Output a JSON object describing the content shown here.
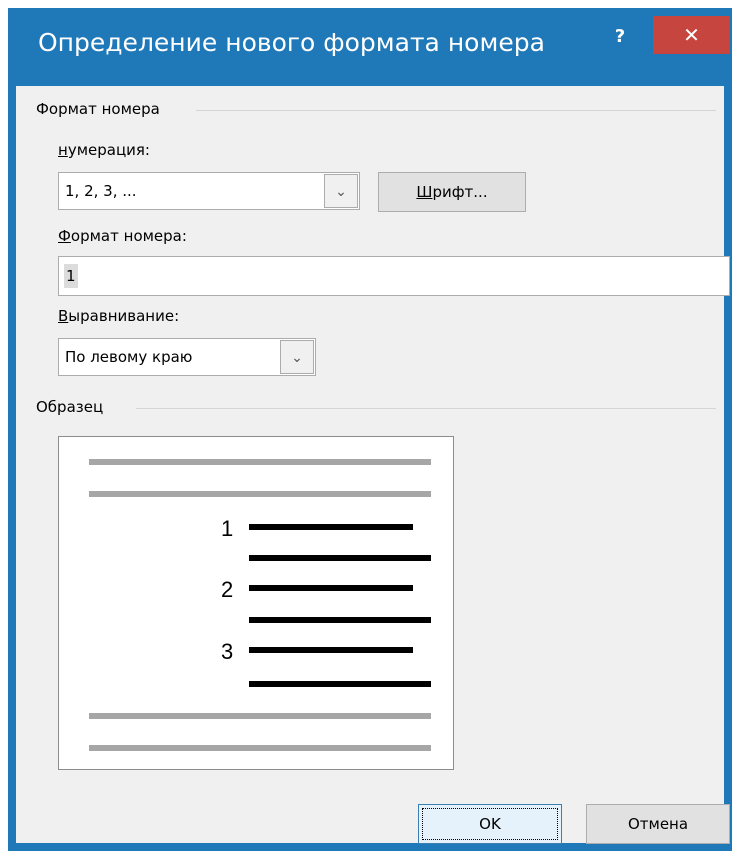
{
  "window": {
    "title": "Определение нового формата номера",
    "help_label": "?",
    "close_label": "✕",
    "accent_color": "#1f78b8",
    "close_color": "#c6463f"
  },
  "number_format_group": {
    "title": "Формат номера",
    "numbering_label_underlined": "н",
    "numbering_label_rest": "умерация:",
    "numbering_value": "1, 2, 3, ...",
    "font_button_underlined": "Ш",
    "font_button_rest": "рифт...",
    "format_label_underlined": "Ф",
    "format_label_rest": "ормат номера:",
    "format_value": "1",
    "alignment_label_underlined": "В",
    "alignment_label_rest": "ыравнивание:",
    "alignment_value": "По левому краю"
  },
  "preview_group": {
    "title": "Образец",
    "numbers": [
      "1",
      "2",
      "3"
    ]
  },
  "buttons": {
    "ok": "OK",
    "cancel": "Отмена"
  }
}
